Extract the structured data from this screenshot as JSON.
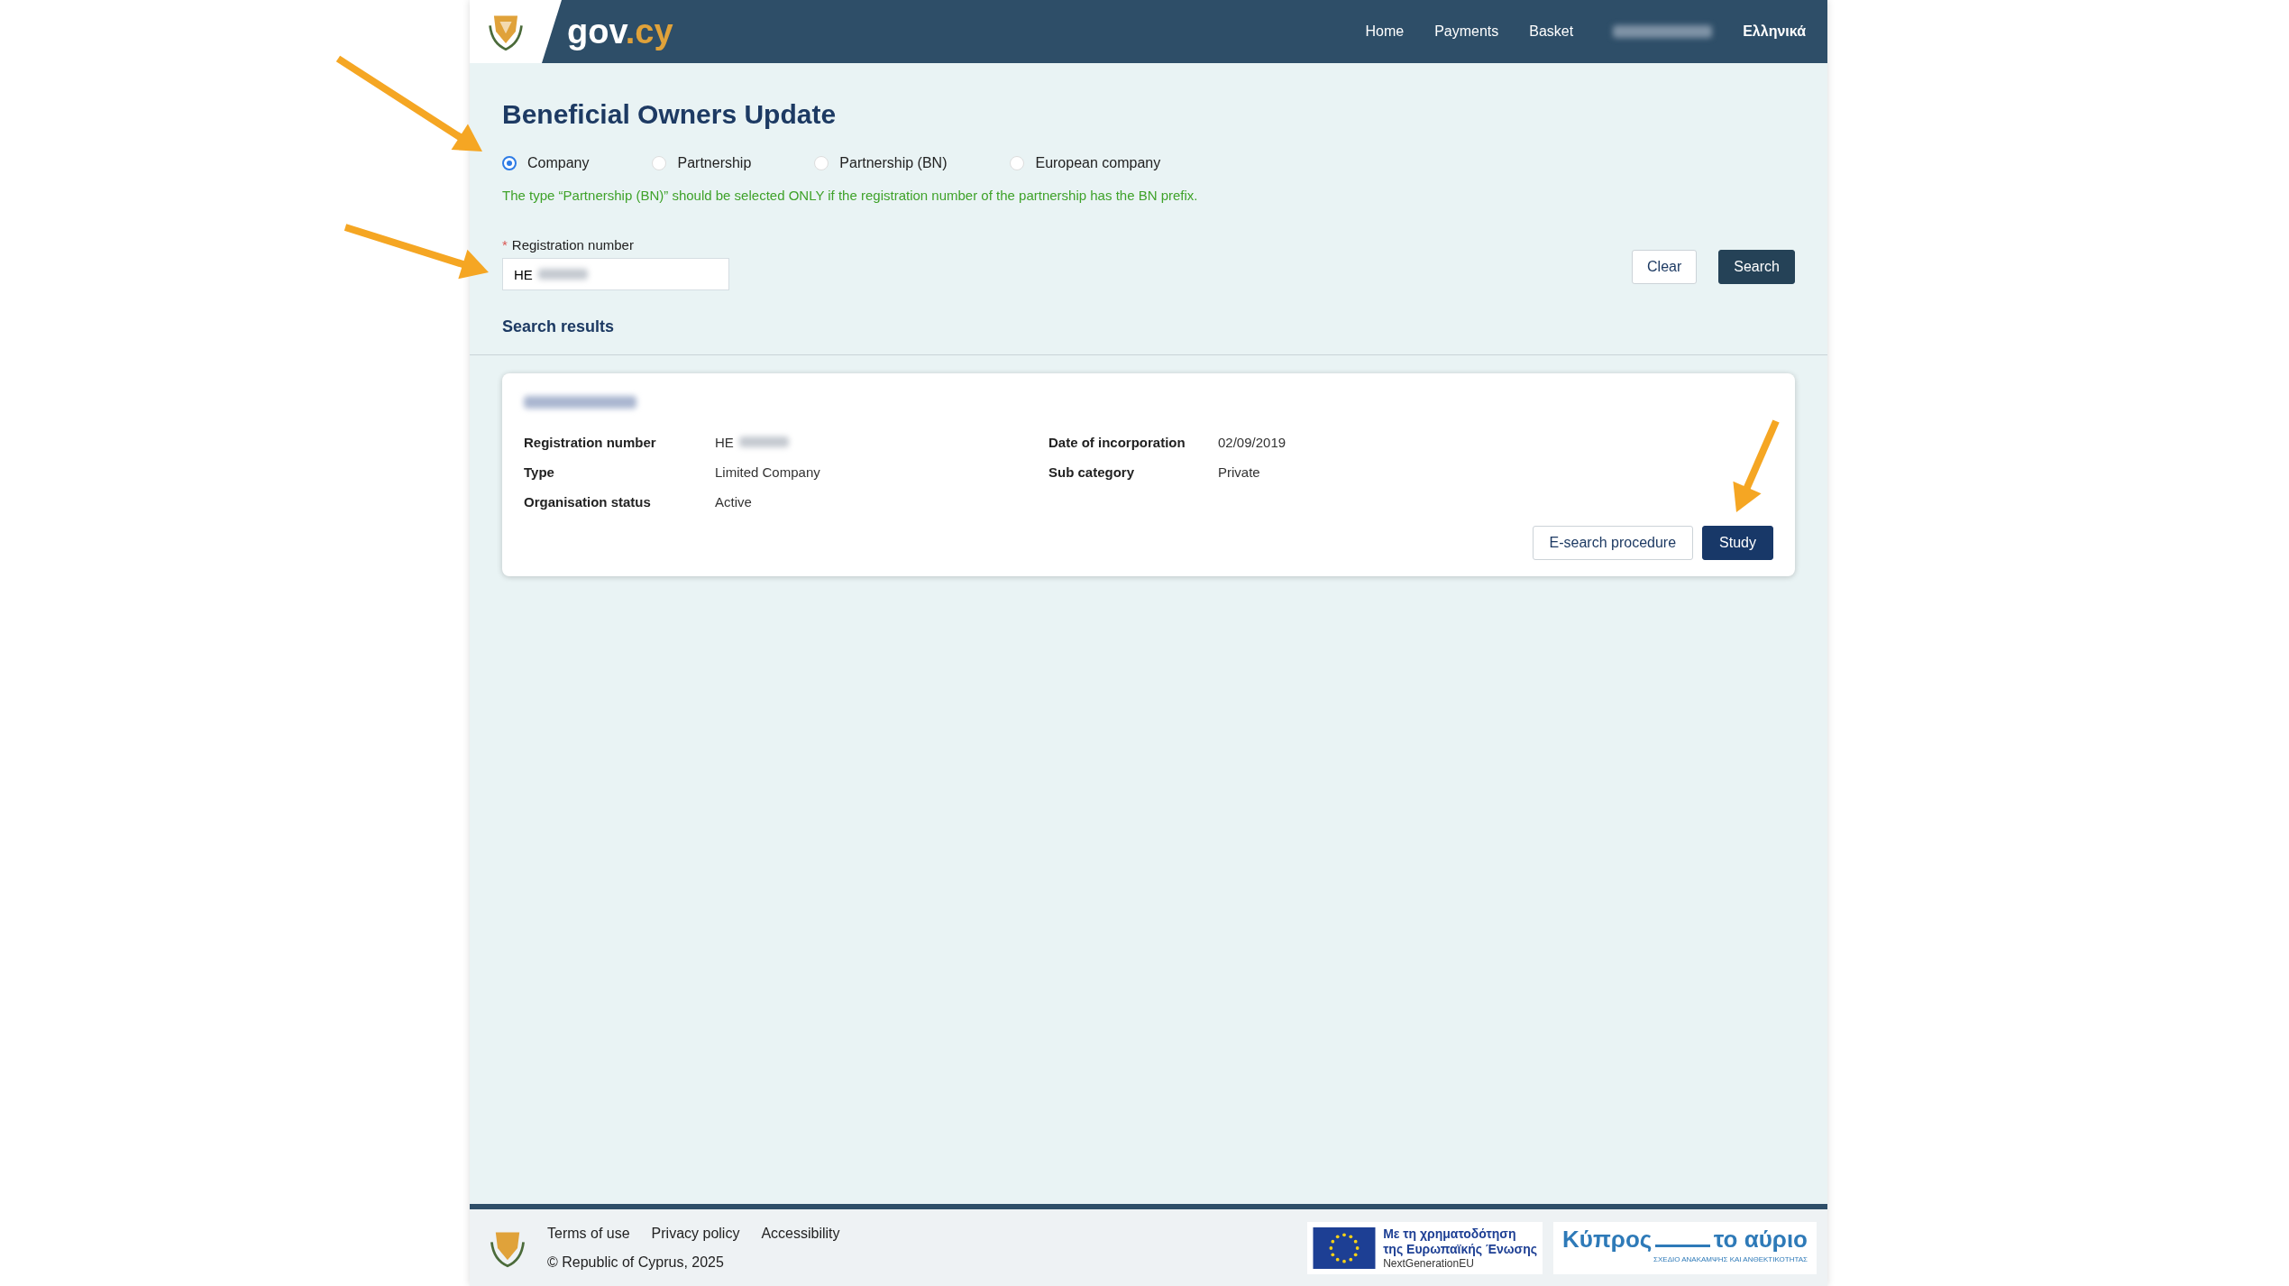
{
  "header": {
    "logo_main": "gov",
    "logo_suffix": ".cy",
    "nav": [
      "Home",
      "Payments",
      "Basket"
    ],
    "user_blurred": true,
    "language": "Ελληνικά"
  },
  "page": {
    "title": "Beneficial Owners Update",
    "types": [
      {
        "label": "Company",
        "selected": true
      },
      {
        "label": "Partnership",
        "selected": false
      },
      {
        "label": "Partnership (BN)",
        "selected": false
      },
      {
        "label": "European company",
        "selected": false
      }
    ],
    "hint": "The type “Partnership (BN)” should be selected ONLY if the registration number of the partnership has the BN prefix.",
    "field": {
      "required_mark": "*",
      "label": "Registration number",
      "value": "HE",
      "value_blurred": true
    },
    "buttons": [
      {
        "label": "Clear",
        "kind": "secondary"
      },
      {
        "label": "Search",
        "kind": "primary"
      }
    ],
    "results_heading": "Search results"
  },
  "result": {
    "name_blurred": true,
    "fields": [
      {
        "label": "Registration number",
        "value": "HE",
        "value_blurred": true
      },
      {
        "label": "Date of incorporation",
        "value": "02/09/2019",
        "value_blurred": false
      },
      {
        "label": "Type",
        "value": "Limited Company",
        "value_blurred": false
      },
      {
        "label": "Sub category",
        "value": "Private",
        "value_blurred": false
      },
      {
        "label": "Organisation status",
        "value": "Active",
        "value_blurred": false
      }
    ],
    "buttons": [
      {
        "label": "E-search procedure",
        "kind": "secondary"
      },
      {
        "label": "Study",
        "kind": "primary"
      }
    ]
  },
  "footer": {
    "links": [
      "Terms of use",
      "Privacy policy",
      "Accessibility"
    ],
    "copyright": "© Republic of Cyprus, 2025",
    "eu_lines": [
      "Με τη χρηματοδότηση",
      "της Ευρωπαϊκής Ένωσης"
    ],
    "eu_sub": "NextGenerationEU",
    "cyprus_left": "Κύπρος",
    "cyprus_right": "το αύριο",
    "cyprus_sub": "ΣΧΕΔΙΟ ΑΝΑΚΑΜΨΗΣ ΚΑΙ ΑΝΘΕΚΤΙΚΟΤΗΤΑΣ"
  }
}
